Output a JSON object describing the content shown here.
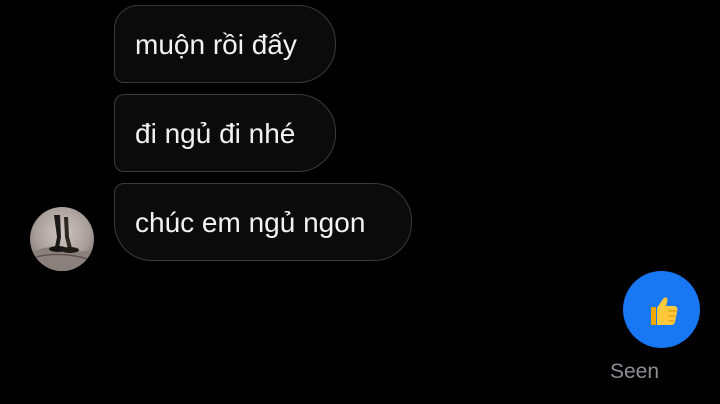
{
  "messages": [
    {
      "text": "muộn rồi đấy"
    },
    {
      "text": "đi ngủ đi nhé"
    },
    {
      "text": "chúc em ngủ ngon"
    }
  ],
  "sender": {
    "avatar_icon": "profile-photo-icon"
  },
  "reaction": {
    "icon": "thumbs-up-icon",
    "color": "#1877f2"
  },
  "status": {
    "label": "Seen"
  }
}
